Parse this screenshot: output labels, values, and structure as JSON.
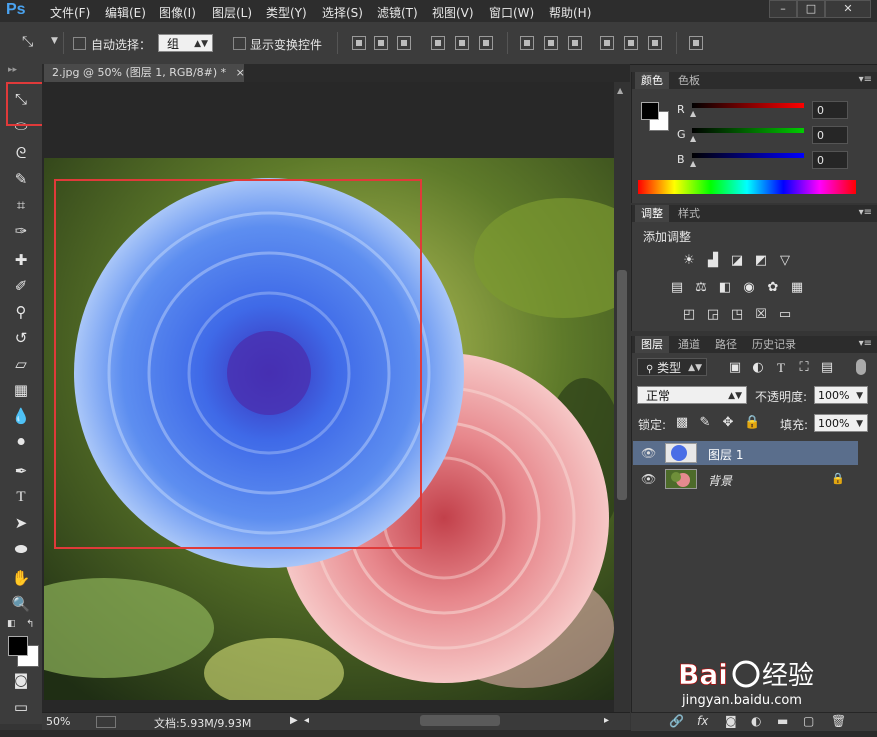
{
  "app": {
    "logo": "Ps"
  },
  "menu": [
    "文件(F)",
    "编辑(E)",
    "图像(I)",
    "图层(L)",
    "类型(Y)",
    "选择(S)",
    "滤镜(T)",
    "视图(V)",
    "窗口(W)",
    "帮助(H)"
  ],
  "window_controls": {
    "minimize": "–",
    "restore": "□",
    "close": "✕"
  },
  "options": {
    "auto_select_label": "自动选择：",
    "auto_select_value": "组",
    "show_transform_label": "显示变换控件"
  },
  "document": {
    "tab_title": "2.jpg @ 50% (图层 1, RGB/8#) *",
    "tab_close": "×"
  },
  "status": {
    "zoom": "50%",
    "doc_info": "文档:5.93M/9.93M"
  },
  "color_panel": {
    "tabs": [
      "颜色",
      "色板"
    ],
    "r_label": "R",
    "g_label": "G",
    "b_label": "B",
    "r_value": "0",
    "g_value": "0",
    "b_value": "0"
  },
  "adjust_panel": {
    "tabs": [
      "调整",
      "样式"
    ],
    "heading": "添加调整"
  },
  "layers_panel": {
    "tabs": [
      "图层",
      "通道",
      "路径",
      "历史记录"
    ],
    "filter_label": "类型",
    "blend_mode": "正常",
    "opacity_label": "不透明度:",
    "opacity_value": "100%",
    "lock_label": "锁定:",
    "fill_label": "填充:",
    "fill_value": "100%",
    "layers": [
      {
        "name": "图层 1",
        "selected": true,
        "locked": false
      },
      {
        "name": "背景",
        "selected": false,
        "locked": true
      }
    ],
    "footer_icons": [
      "link-icon",
      "fx-icon",
      "mask-icon",
      "adjustment-icon",
      "group-icon",
      "new-layer-icon",
      "trash-icon"
    ],
    "fx_label": "fx"
  },
  "colors": {
    "accent": "#4aa3f0",
    "highlight_box": "#e03a3a",
    "selected_layer": "#5a6e8c"
  }
}
